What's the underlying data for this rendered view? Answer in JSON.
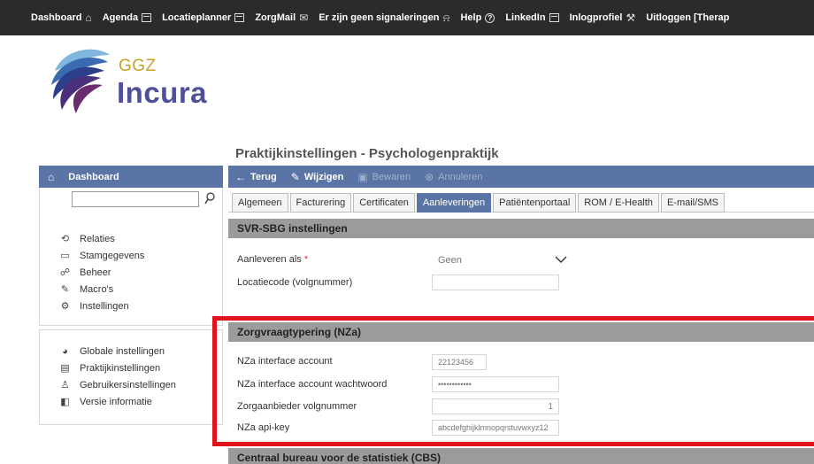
{
  "topbar": {
    "items": [
      {
        "label": "Dashboard",
        "icon": "home-icon"
      },
      {
        "label": "Agenda",
        "icon": "calendar-icon"
      },
      {
        "label": "Locatieplanner",
        "icon": "calendar-icon"
      },
      {
        "label": "ZorgMail",
        "icon": "mail-icon"
      },
      {
        "label": "Er zijn geen signaleringen",
        "icon": "bell-icon"
      },
      {
        "label": "Help",
        "icon": "help-icon"
      },
      {
        "label": "LinkedIn",
        "icon": "linkedin-icon"
      },
      {
        "label": "Inlogprofiel",
        "icon": "wrench-icon"
      },
      {
        "label": "Uitloggen [Therap",
        "icon": ""
      }
    ]
  },
  "logo": {
    "line1": "GGZ",
    "line2": "Incura"
  },
  "sidebar": {
    "header": "Dashboard",
    "search_value": "",
    "group1": [
      {
        "label": "Relaties",
        "icon": "relations-icon"
      },
      {
        "label": "Stamgegevens",
        "icon": "card-icon"
      },
      {
        "label": "Beheer",
        "icon": "users-icon"
      },
      {
        "label": "Macro's",
        "icon": "edit-icon"
      },
      {
        "label": "Instellingen",
        "icon": "gear-icon"
      }
    ],
    "group2": [
      {
        "label": "Globale instellingen",
        "icon": "globe-icon"
      },
      {
        "label": "Praktijkinstellingen",
        "icon": "building-icon"
      },
      {
        "label": "Gebruikersinstellingen",
        "icon": "user-settings-icon"
      },
      {
        "label": "Versie informatie",
        "icon": "info-icon"
      }
    ]
  },
  "page": {
    "title": "Praktijkinstellingen - Psychologenpraktijk"
  },
  "toolbar": {
    "back": "Terug",
    "edit": "Wijzigen",
    "save": "Bewaren",
    "cancel": "Annuleren"
  },
  "tabs": [
    "Algemeen",
    "Facturering",
    "Certificaten",
    "Aanleveringen",
    "Patiëntenportaal",
    "ROM / E-Health",
    "E-mail/SMS"
  ],
  "active_tab": "Aanleveringen",
  "sections": {
    "svr": {
      "title": "SVR-SBG instellingen",
      "aanleveren_label": "Aanleveren als",
      "aanleveren_value": "Geen",
      "locatiecode_label": "Locatiecode (volgnummer)",
      "locatiecode_value": ""
    },
    "nza": {
      "title": "Zorgvraagtypering (NZa)",
      "account_label": "NZa interface account",
      "account_value": "22123456",
      "password_label": "NZa interface account wachtwoord",
      "password_value": "••••••••••••",
      "volgnummer_label": "Zorgaanbieder volgnummer",
      "volgnummer_value": "1",
      "apikey_label": "NZa api-key",
      "apikey_value": "abcdefghijklmnopqrstuvwxyz12"
    },
    "cbs": {
      "title": "Centraal bureau voor de statistiek (CBS)"
    }
  },
  "colors": {
    "topbar": "#2b2b2b",
    "accent": "#5a74a5",
    "section_head": "#9b9b9b",
    "highlight": "#e2131b",
    "logo_gold": "#c8a12a",
    "logo_purple": "#4f4f9a"
  }
}
